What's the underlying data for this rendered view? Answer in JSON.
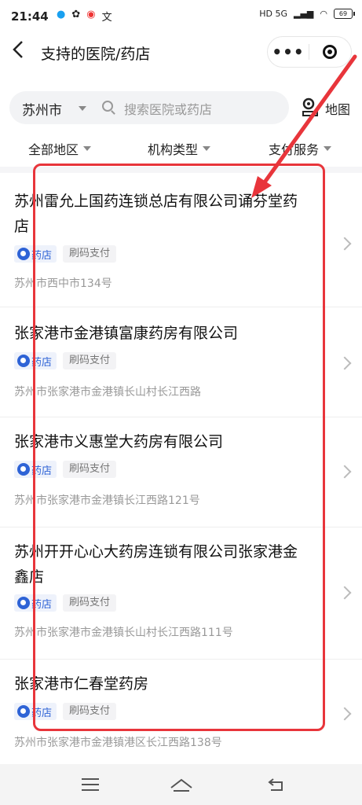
{
  "status_bar": {
    "time": "21:44",
    "notifications": [
      "●",
      "✿",
      "◉",
      "文"
    ],
    "network": "HD 5G",
    "battery": "69"
  },
  "nav": {
    "title": "支持的医院/药店",
    "capsule_more": "•••"
  },
  "search": {
    "city": "苏州市",
    "placeholder": "搜索医院或药店",
    "map_label": "地图"
  },
  "filters": [
    "全部地区",
    "机构类型",
    "支付服务"
  ],
  "tags": {
    "shop": "药店",
    "pay": "刷码支付"
  },
  "items": [
    {
      "name": "苏州雷允上国药连锁总店有限公司诵芬堂药店",
      "address": "苏州市西中市134号"
    },
    {
      "name": "张家港市金港镇富康药房有限公司",
      "address": "苏州市张家港市金港镇长山村长江西路"
    },
    {
      "name": "张家港市义惠堂大药房有限公司",
      "address": "苏州市张家港市金港镇长江西路121号"
    },
    {
      "name": "苏州开开心心大药房连锁有限公司张家港金鑫店",
      "address": "苏州市张家港市金港镇长山村长江西路111号"
    },
    {
      "name": "张家港市仁春堂药房",
      "address": "苏州市张家港市金港镇港区长江西路138号"
    }
  ],
  "colors": {
    "accent_blue": "#2e63d6",
    "annotation_red": "#e8353b"
  }
}
